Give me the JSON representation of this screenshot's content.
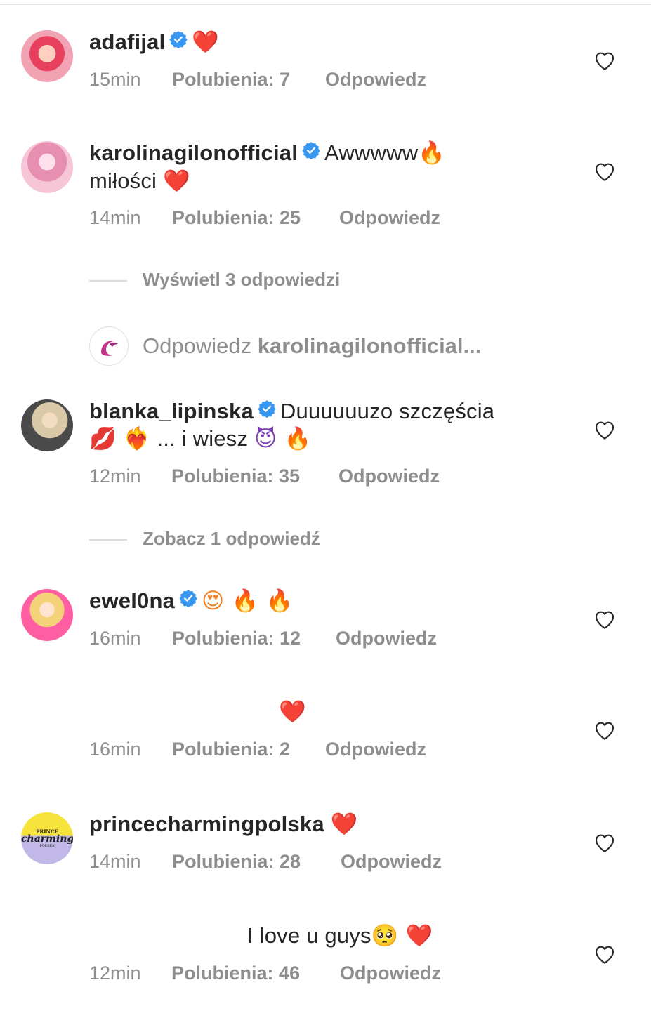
{
  "comments": [
    {
      "username": "adafijal",
      "verified": true,
      "text": "",
      "emojis": "❤️",
      "time": "15min",
      "likes": "Polubienia: 7",
      "reply": "Odpowiedz",
      "avatar_colors": [
        "#f2a3b3",
        "#e7405f"
      ]
    },
    {
      "username": "karolinagilonofficial",
      "verified": true,
      "text": "Awwwww",
      "text_line2": "miłości",
      "emojis": "🔥",
      "emojis_line2": "❤️",
      "time": "14min",
      "likes": "Polubienia: 25",
      "reply": "Odpowiedz",
      "avatar_colors": [
        "#f7c6d6",
        "#e78fb0"
      ]
    },
    {
      "username": "blanka_lipinska",
      "verified": true,
      "text": "Duuuuuuzo szczęścia",
      "text_line2": "... i wiesz",
      "emojis_line2_pre": "💋 ❤️‍🔥",
      "emojis_line2_post": "😈 🔥",
      "time": "12min",
      "likes": "Polubienia: 35",
      "reply": "Odpowiedz",
      "avatar_colors": [
        "#4a4a4a",
        "#d9c9a8"
      ]
    },
    {
      "username": "ewel0na",
      "verified": true,
      "emojis": "😍 🔥 🔥",
      "time": "16min",
      "likes": "Polubienia: 12",
      "reply": "Odpowiedz",
      "avatar_colors": [
        "#ff5fa2",
        "#f4d27a"
      ]
    },
    {
      "username": "",
      "emojis": "❤️",
      "time": "16min",
      "likes": "Polubienia: 2",
      "reply": "Odpowiedz"
    },
    {
      "username": "princecharmingpolska",
      "verified": false,
      "emojis": "❤️",
      "time": "14min",
      "likes": "Polubienia: 28",
      "reply": "Odpowiedz",
      "avatar_text_top": "PRINCE",
      "avatar_text_main": "charming",
      "avatar_text_bottom": "POLSKA",
      "avatar_colors": [
        "#f6e43c",
        "#c2b8e8"
      ]
    },
    {
      "username": "",
      "text": "I love u guys",
      "emojis": "🥺 ❤️",
      "time": "12min",
      "likes": "Polubienia: 46",
      "reply": "Odpowiedz"
    }
  ],
  "view_replies_1": "Wyświetl 3 odpowiedzi",
  "view_replies_2": "Zobacz 1 odpowiedź",
  "reply_input": {
    "prefix": "Odpowiedz",
    "target": "karolinagilonofficial..."
  },
  "colors": {
    "text": "#262626",
    "meta": "#8e8e8e",
    "verified": "#3897f0",
    "heart": "#e0245e"
  },
  "icons": [
    "verified-badge-icon",
    "heart-outline-icon",
    "like-heart-emoji"
  ]
}
